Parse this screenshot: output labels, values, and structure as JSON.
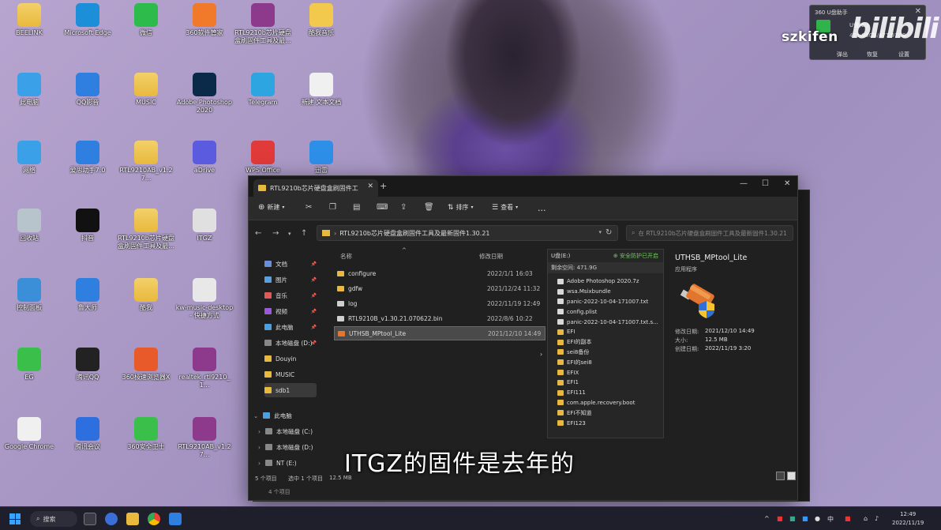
{
  "desktop_icons": [
    {
      "label": "BEELINK",
      "icon": "folder-icon"
    },
    {
      "label": "Microsoft Edge",
      "icon": "edge-icon"
    },
    {
      "label": "微信",
      "icon": "wechat-icon"
    },
    {
      "label": "360软件管家",
      "icon": "360-manager-icon"
    },
    {
      "label": "RTL9210b芯片硬盘盒刷固件工具及最...",
      "icon": "winrar-icon"
    },
    {
      "label": "酷我音乐",
      "icon": "kuwo-music-icon"
    },
    {
      "label": "此电脑",
      "icon": "this-pc-icon"
    },
    {
      "label": "QQ影音",
      "icon": "qq-player-icon"
    },
    {
      "label": "MUSIC",
      "icon": "folder-icon"
    },
    {
      "label": "Adobe Photoshop 2020",
      "icon": "photoshop-icon"
    },
    {
      "label": "Telegram",
      "icon": "telegram-icon"
    },
    {
      "label": "新建 文本文档",
      "icon": "text-document-icon"
    },
    {
      "label": "网络",
      "icon": "network-icon"
    },
    {
      "label": "爱思助手7.0",
      "icon": "i4-assistant-icon"
    },
    {
      "label": "RTL9210AB_v1.27...",
      "icon": "folder-icon"
    },
    {
      "label": "aDrive",
      "icon": "adrive-icon"
    },
    {
      "label": "WPS Office",
      "icon": "wps-icon"
    },
    {
      "label": "迅雷",
      "icon": "thunder-icon"
    },
    {
      "label": "回收站",
      "icon": "recycle-bin-icon"
    },
    {
      "label": "抖音",
      "icon": "douyin-icon"
    },
    {
      "label": "RTL9210b芯片硬盘盒刷固件工具及最...",
      "icon": "folder-icon"
    },
    {
      "label": "ITGZ",
      "icon": "itgz-icon"
    },
    {
      "label": "控制面板",
      "icon": "control-panel-icon"
    },
    {
      "label": "鲁大师",
      "icon": "ludashi-icon"
    },
    {
      "label": "酷我",
      "icon": "folder-icon"
    },
    {
      "label": "kw-music-desktop - 快捷方式",
      "icon": "kw-music-shortcut-icon"
    },
    {
      "label": "EG",
      "icon": "eg-icon"
    },
    {
      "label": "腾讯QQ",
      "icon": "qq-icon"
    },
    {
      "label": "360极速浏览器X",
      "icon": "360-browser-icon"
    },
    {
      "label": "realtek_rtl9210_1...",
      "icon": "winrar-icon"
    },
    {
      "label": "Google Chrome",
      "icon": "chrome-icon"
    },
    {
      "label": "腾讯会议",
      "icon": "tencent-meeting-icon"
    },
    {
      "label": "360安全卫士",
      "icon": "360-security-icon"
    },
    {
      "label": "RTL9210AB_v1.27...",
      "icon": "winrar-icon"
    }
  ],
  "popup": {
    "title": "360 U盘助手",
    "name": "U盘(E:)",
    "space": "471.96GB/471.97GB",
    "actions": [
      "弹出",
      "恢复",
      "设置"
    ]
  },
  "watermark": {
    "text": "szkifen",
    "logo": "bilibili"
  },
  "explorer": {
    "tab_title": "RTL9210b芯片硬盘盒刷固件工",
    "toolbar": {
      "new": "新建",
      "sort": "排序",
      "view": "查看",
      "more": "..."
    },
    "address": "RTL9210b芯片硬盘盒刷固件工具及最新固件1.30.21",
    "search_placeholder": "在 RTL9210b芯片硬盘盒刷固件工具及最新固件1.30.21",
    "sidebar": [
      {
        "label": "文档",
        "color": "#6a8fd8",
        "pinned": true
      },
      {
        "label": "图片",
        "color": "#5aa0e0",
        "pinned": true
      },
      {
        "label": "音乐",
        "color": "#e05a5a",
        "pinned": true
      },
      {
        "label": "视频",
        "color": "#9a5ad8",
        "pinned": true
      },
      {
        "label": "此电脑",
        "color": "#4aa0e0",
        "pinned": true
      },
      {
        "label": "本地磁盘 (D:)",
        "color": "#888888",
        "pinned": true
      },
      {
        "label": "Douyin",
        "color": "#e8b93c",
        "pinned": false
      },
      {
        "label": "MUSIC",
        "color": "#e8b93c",
        "pinned": false
      },
      {
        "label": "sdb1",
        "color": "#e8b93c",
        "pinned": false
      }
    ],
    "tree": [
      {
        "label": "此电脑",
        "color": "#4aa0e0"
      },
      {
        "label": "本地磁盘 (C:)",
        "color": "#888888"
      },
      {
        "label": "本地磁盘 (D:)",
        "color": "#888888"
      },
      {
        "label": "NT (E:)",
        "color": "#888888"
      }
    ],
    "columns": {
      "name": "名称",
      "date": "修改日期"
    },
    "files": [
      {
        "name": "configure",
        "date": "2022/1/1 16:03",
        "type": "folder"
      },
      {
        "name": "gdfw",
        "date": "2021/12/24 11:32",
        "type": "folder"
      },
      {
        "name": "log",
        "date": "2022/11/19 12:49",
        "type": "file"
      },
      {
        "name": "RTL9210B_v1.30.21.070622.bin",
        "date": "2022/8/6 10:22",
        "type": "file"
      },
      {
        "name": "UTHSB_MPtool_Lite",
        "date": "2021/12/10 14:49",
        "type": "exe"
      }
    ],
    "status": {
      "count": "5 个项目",
      "selected": "选中 1 个项目",
      "size": "12.5 MB"
    },
    "status2": "4 个项目",
    "details": {
      "name": "UTHSB_MPtool_Lite",
      "type": "应用程序",
      "rows": [
        {
          "label": "修改日期:",
          "value": "2021/12/10 14:49"
        },
        {
          "label": "大小:",
          "value": "12.5 MB"
        },
        {
          "label": "创建日期:",
          "value": "2022/11/19 3:20"
        }
      ]
    }
  },
  "udisk_panel": {
    "title": "U盘(E:)",
    "protection": "安全防护已开启",
    "free_space": "剩余空间: 471.9G",
    "items": [
      {
        "name": "Adobe Photoshop 2020.7z",
        "type": "file"
      },
      {
        "name": "wsa.Msixbundle",
        "type": "file"
      },
      {
        "name": "panic-2022-10-04-171007.txt",
        "type": "file"
      },
      {
        "name": "config.plist",
        "type": "file"
      },
      {
        "name": "panic-2022-10-04-171007.txt.s...",
        "type": "file"
      },
      {
        "name": "EFI",
        "type": "folder"
      },
      {
        "name": "EFI的副本",
        "type": "folder"
      },
      {
        "name": "sei8备份",
        "type": "folder"
      },
      {
        "name": "EFI的sei8",
        "type": "folder"
      },
      {
        "name": "EFIX",
        "type": "folder"
      },
      {
        "name": "EFI1",
        "type": "folder"
      },
      {
        "name": "EFI111",
        "type": "folder"
      },
      {
        "name": "com.apple.recovery.boot",
        "type": "folder"
      },
      {
        "name": "EFI不知道",
        "type": "folder"
      },
      {
        "name": "EFI123",
        "type": "folder"
      }
    ]
  },
  "subtitle": "ITGZ的固件是去年的",
  "taskbar": {
    "search": "搜索",
    "ime": "中",
    "time": "12:49",
    "date": "2022/11/19"
  }
}
